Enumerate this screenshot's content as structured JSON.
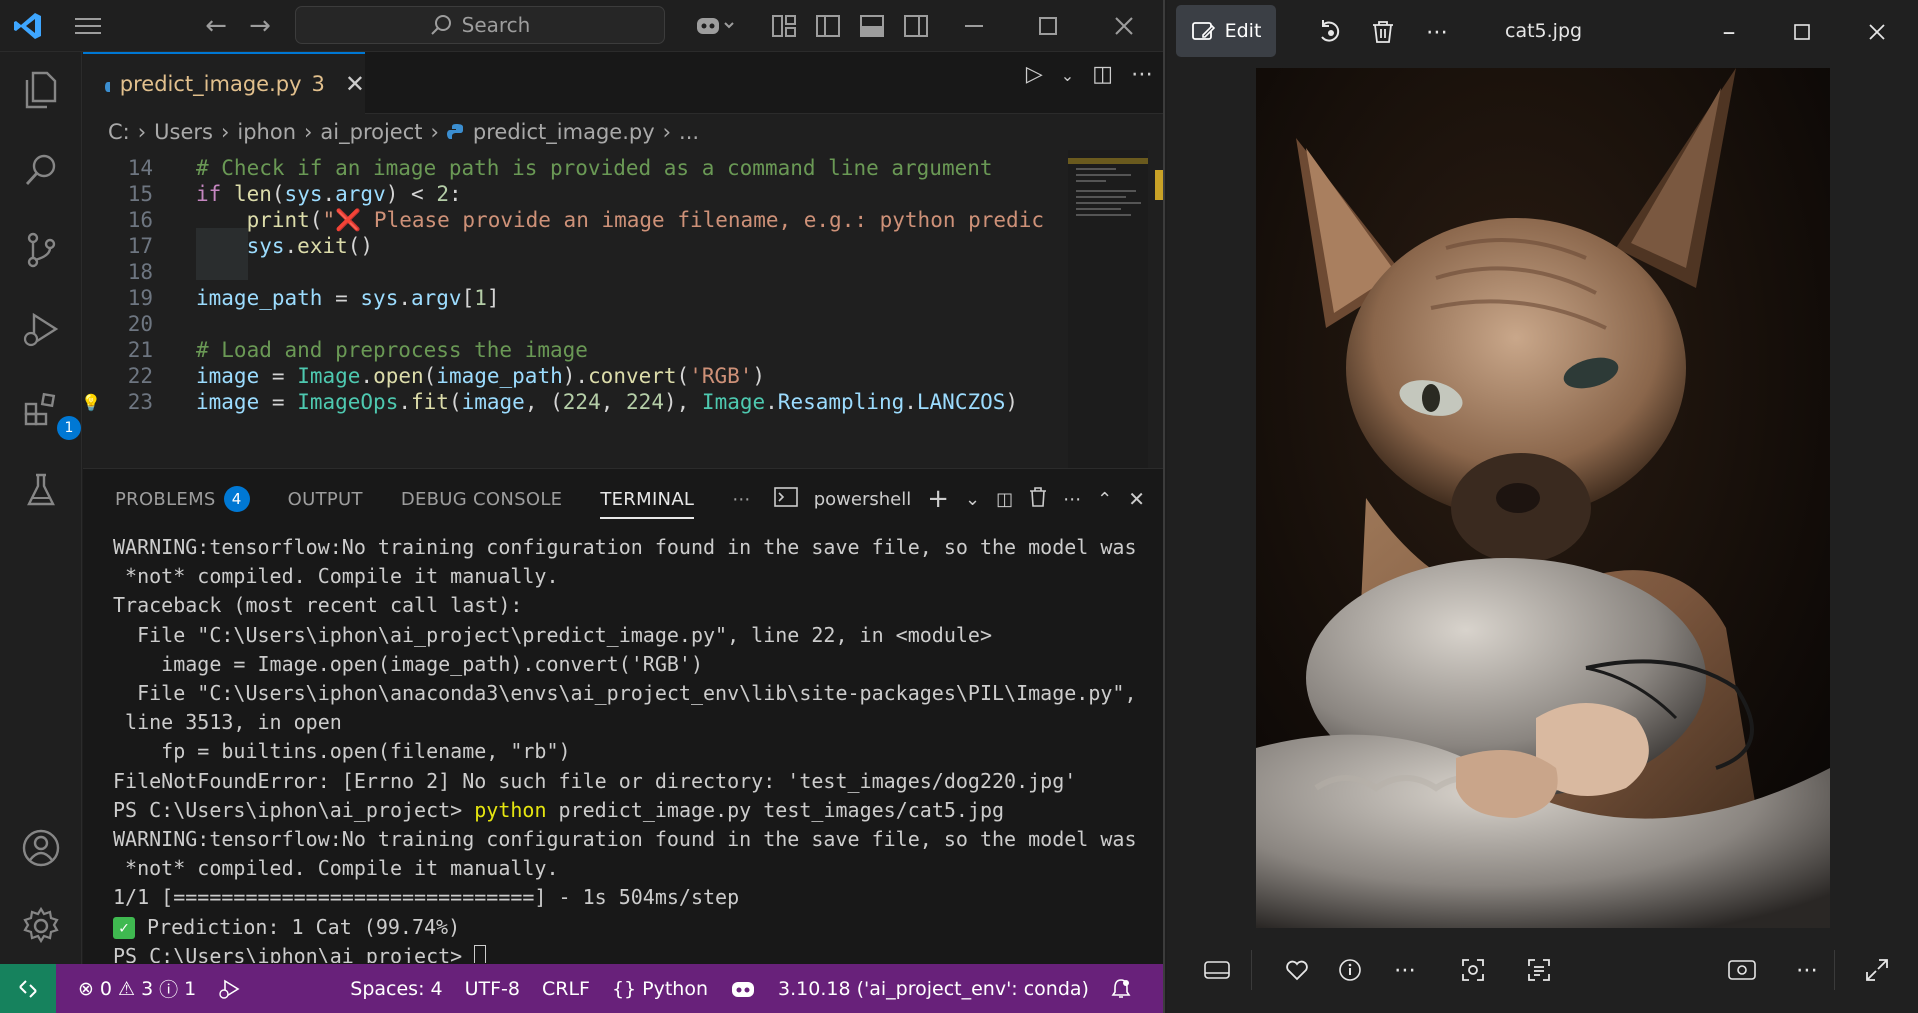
{
  "vscode": {
    "search_placeholder": "Search",
    "tab": {
      "filename": "predict_image.py",
      "problem_count": "3"
    },
    "breadcrumb": [
      "C:",
      "Users",
      "iphon",
      "ai_project",
      "predict_image.py",
      "..."
    ],
    "editor_lines": [
      {
        "n": "14",
        "code": "# Check if an image path is provided as a command line argument"
      },
      {
        "n": "15",
        "code": "if len(sys.argv) < 2:"
      },
      {
        "n": "16",
        "code": "    print(\"❌ Please provide an image filename, e.g.: python predic"
      },
      {
        "n": "17",
        "code": "    sys.exit()"
      },
      {
        "n": "18",
        "code": ""
      },
      {
        "n": "19",
        "code": "image_path = sys.argv[1]"
      },
      {
        "n": "20",
        "code": ""
      },
      {
        "n": "21",
        "code": "# Load and preprocess the image"
      },
      {
        "n": "22",
        "code": "image = Image.open(image_path).convert('RGB')"
      },
      {
        "n": "23",
        "code": "image = ImageOps.fit(image, (224, 224), Image.Resampling.LANCZOS)"
      }
    ],
    "panel": {
      "tabs": [
        "PROBLEMS",
        "OUTPUT",
        "DEBUG CONSOLE",
        "TERMINAL"
      ],
      "problems_badge": "4",
      "shell": "powershell",
      "terminal_lines": [
        "WARNING:tensorflow:No training configuration found in the save file, so the model was",
        " *not* compiled. Compile it manually.",
        "Traceback (most recent call last):",
        "  File \"C:\\Users\\iphon\\ai_project\\predict_image.py\", line 22, in <module>",
        "    image = Image.open(image_path).convert('RGB')",
        "  File \"C:\\Users\\iphon\\anaconda3\\envs\\ai_project_env\\lib\\site-packages\\PIL\\Image.py\",",
        " line 3513, in open",
        "    fp = builtins.open(filename, \"rb\")",
        "FileNotFoundError: [Errno 2] No such file or directory: 'test_images/dog220.jpg'"
      ],
      "prompt": "PS C:\\Users\\iphon\\ai_project>",
      "command_keyword": "python",
      "command_args": "predict_image.py test_images/cat5.jpg",
      "terminal_lines_after": [
        "WARNING:tensorflow:No training configuration found in the save file, so the model was",
        " *not* compiled. Compile it manually.",
        "1/1 [==============================] - 1s 504ms/step"
      ],
      "prediction": "Prediction: 1 Cat (99.74%)",
      "final_prompt": "PS C:\\Users\\iphon\\ai_project>"
    },
    "statusbar": {
      "errors": "0",
      "warnings": "3",
      "infos": "1",
      "spaces": "Spaces: 4",
      "encoding": "UTF-8",
      "eol": "CRLF",
      "language": "Python",
      "interpreter": "3.10.18 ('ai_project_env': conda)"
    },
    "extensions_badge": "1"
  },
  "photos": {
    "edit_label": "Edit",
    "filename": "cat5.jpg"
  }
}
